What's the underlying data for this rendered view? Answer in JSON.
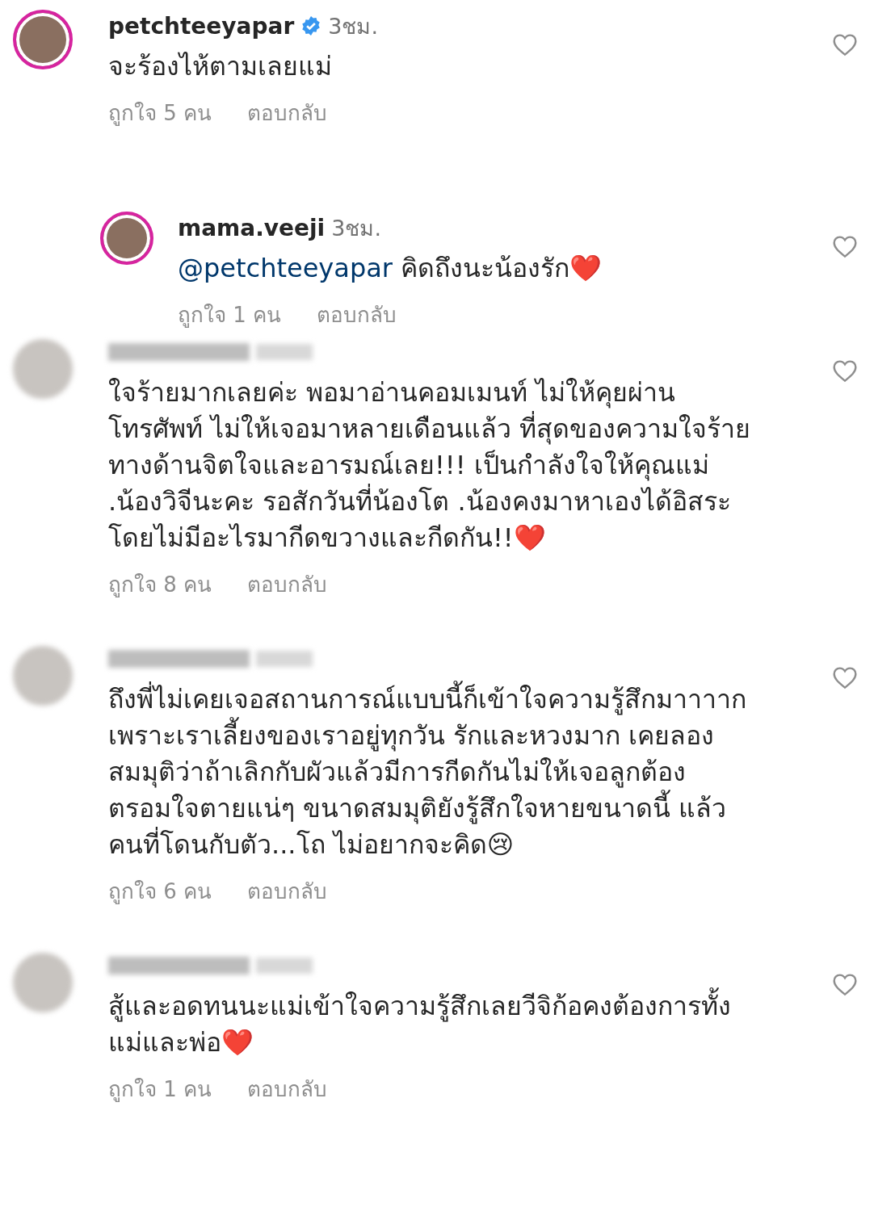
{
  "comments": [
    {
      "username": "petchteeyapar",
      "verified": true,
      "time": "3ชม.",
      "story_ring": true,
      "name_blurred": false,
      "text": "จะร้องไห้ตามเลยแม่",
      "likes": "ถูกใจ 5 คน",
      "reply": "ตอบกลับ",
      "liked": false,
      "children": [
        {
          "username": "mama.veeji",
          "verified": false,
          "time": "3ชม.",
          "story_ring": true,
          "name_blurred": false,
          "mention": "@petchteeyapar",
          "text": "คิดถึงนะน้องรัก❤️",
          "likes": "ถูกใจ 1 คน",
          "reply": "ตอบกลับ",
          "liked": false
        }
      ]
    },
    {
      "story_ring": false,
      "name_blurred": true,
      "text": "ใจร้ายมากเลยค่ะ พอมาอ่านคอมเมนท์ ไม่ให้คุยผ่านโทรศัพท์ ไม่ให้เจอมาหลายเดือนแล้ว ที่สุดของความใจร้าย ทางด้านจิตใจและอารมณ์เลย!!! เป็นกำลังใจให้คุณแม่ .น้องวิจีนะคะ รอสักวันที่น้องโต .น้องคงมาหาเองได้อิสระ โดยไม่มีอะไรมากีดขวางและกีดกัน!!❤️",
      "likes": "ถูกใจ 8 คน",
      "reply": "ตอบกลับ",
      "liked": false
    },
    {
      "story_ring": false,
      "name_blurred": true,
      "text": "ถึงพี่ไม่เคยเจอสถานการณ์แบบนี้ก็เข้าใจความรู้สึกมาาาาก เพราะเราเลี้ยงของเราอยู่ทุกวัน รักและหวงมาก เคยลองสมมุติว่าถ้าเลิกกับผัวแล้วมีการกีดกันไม่ให้เจอลูกต้องตรอมใจตายแน่ๆ ขนาดสมมุติยังรู้สึกใจหายขนาดนี้ แล้วคนที่โดนกับตัว...โถ ไม่อยากจะคิด😢",
      "likes": "ถูกใจ 6 คน",
      "reply": "ตอบกลับ",
      "liked": false
    },
    {
      "story_ring": false,
      "name_blurred": true,
      "text": "สู้และอดทนนะแม่เข้าใจความรู้สึกเลยวีจิก้อคงต้องการทั้งแม่และพ่อ❤️",
      "likes": "ถูกใจ 1 คน",
      "reply": "ตอบกลับ",
      "liked": false
    }
  ]
}
